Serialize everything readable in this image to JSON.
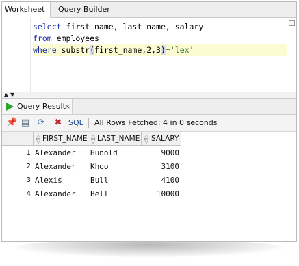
{
  "tabs": [
    {
      "label": "Worksheet",
      "active": true
    },
    {
      "label": "Query Builder",
      "active": false
    }
  ],
  "editor": {
    "lines": [
      {
        "tokens": [
          {
            "t": "select",
            "k": "kw"
          },
          {
            "t": " first_name, last_name, salary",
            "k": "id"
          }
        ]
      },
      {
        "tokens": [
          {
            "t": "from",
            "k": "kw"
          },
          {
            "t": " employees",
            "k": "id"
          }
        ]
      },
      {
        "tokens": [
          {
            "t": "where",
            "k": "kw"
          },
          {
            "t": " substr",
            "k": "id"
          },
          {
            "t": "(",
            "k": "paren"
          },
          {
            "t": "first_name,2,3",
            "k": "id"
          },
          {
            "t": ")",
            "k": "paren"
          },
          {
            "t": "=",
            "k": "id"
          },
          {
            "t": "'lex'",
            "k": "str"
          }
        ]
      }
    ],
    "current_line": 2
  },
  "result_panel": {
    "tab_label": "Query Result",
    "close_label": "×",
    "toolbar": {
      "pin_icon": "pin-icon",
      "print_icon": "printer-icon",
      "refresh_icon": "refresh-icon",
      "cancel_icon": "cancel-icon",
      "sql_label": "SQL",
      "separator": "|",
      "status": "All Rows Fetched: 4 in 0 seconds"
    }
  },
  "grid": {
    "columns": [
      "FIRST_NAME",
      "LAST_NAME",
      "SALARY"
    ],
    "rows": [
      {
        "num": "1",
        "first_name": "Alexander",
        "last_name": "Hunold",
        "salary": "9000"
      },
      {
        "num": "2",
        "first_name": "Alexander",
        "last_name": "Khoo",
        "salary": "3100"
      },
      {
        "num": "3",
        "first_name": "Alexis",
        "last_name": "Bull",
        "salary": "4100"
      },
      {
        "num": "4",
        "first_name": "Alexander",
        "last_name": "Bell",
        "salary": "10000"
      }
    ]
  },
  "colors": {
    "keyword": "#1c2ca8",
    "string": "#2f7a2f",
    "current_line": "#fcfcd2",
    "run_green": "#2ea52e"
  }
}
